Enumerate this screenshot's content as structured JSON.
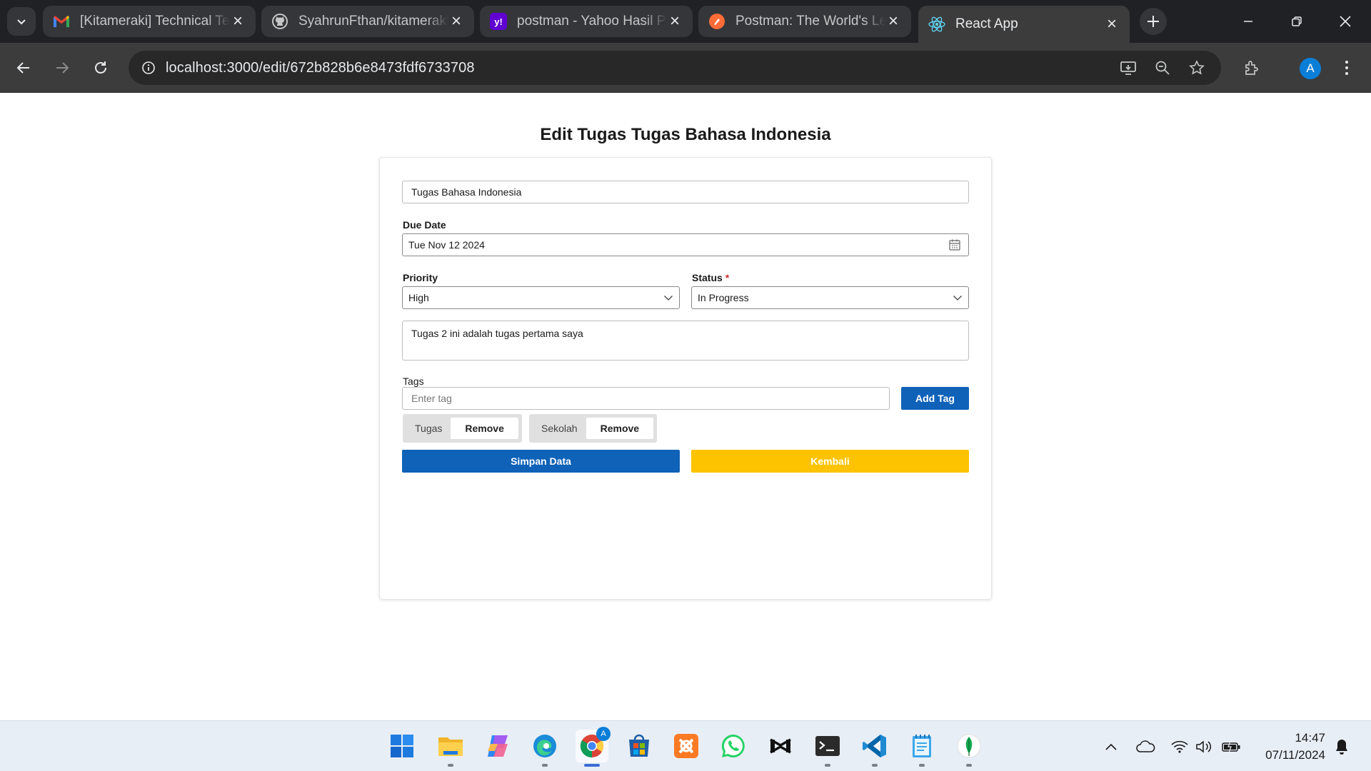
{
  "browser": {
    "tabs": [
      {
        "title": "[Kitameraki] Technical Test",
        "favicon": "gmail-icon",
        "active": false
      },
      {
        "title": "SyahrunFthan/kitameraki",
        "favicon": "github-icon",
        "active": false
      },
      {
        "title": "postman - Yahoo Hasil Pencarian",
        "favicon": "yahoo-icon",
        "active": false
      },
      {
        "title": "Postman: The World's Leading",
        "favicon": "postman-icon",
        "active": false
      },
      {
        "title": "React App",
        "favicon": "react-icon",
        "active": true
      }
    ],
    "url": "localhost:3000/edit/672b828b6e8473fdf6733708",
    "profile_initial": "A",
    "favicon_text": {
      "yahoo": "y!"
    }
  },
  "page": {
    "title": "Edit Tugas Tugas Bahasa Indonesia",
    "form": {
      "title_value": "Tugas Bahasa Indonesia",
      "due_date_label": "Due Date",
      "due_date_value": "Tue Nov 12 2024",
      "priority_label": "Priority",
      "priority_value": "High",
      "status_label": "Status",
      "status_required": "*",
      "status_value": "In Progress",
      "description_value": "Tugas 2 ini adalah tugas pertama saya",
      "tags_label": "Tags",
      "tag_placeholder": "Enter tag",
      "add_tag_label": "Add Tag",
      "tags": [
        {
          "name": "Tugas",
          "remove_label": "Remove"
        },
        {
          "name": "Sekolah",
          "remove_label": "Remove"
        }
      ],
      "save_label": "Simpan Data",
      "back_label": "Kembali"
    }
  },
  "colors": {
    "primary_button": "#0f62b8",
    "back_button": "#fdc300",
    "required_mark": "#d32f2f"
  },
  "taskbar": {
    "apps": [
      "windows-start-icon",
      "file-explorer-icon",
      "copilot-icon",
      "edge-icon",
      "chrome-icon",
      "microsoft-store-icon",
      "xampp-icon",
      "whatsapp-icon",
      "capcut-icon",
      "terminal-icon",
      "vscode-icon",
      "notepad-icon",
      "mongodb-compass-icon"
    ],
    "chrome_badge": "A",
    "time": "14:47",
    "date": "07/11/2024"
  }
}
